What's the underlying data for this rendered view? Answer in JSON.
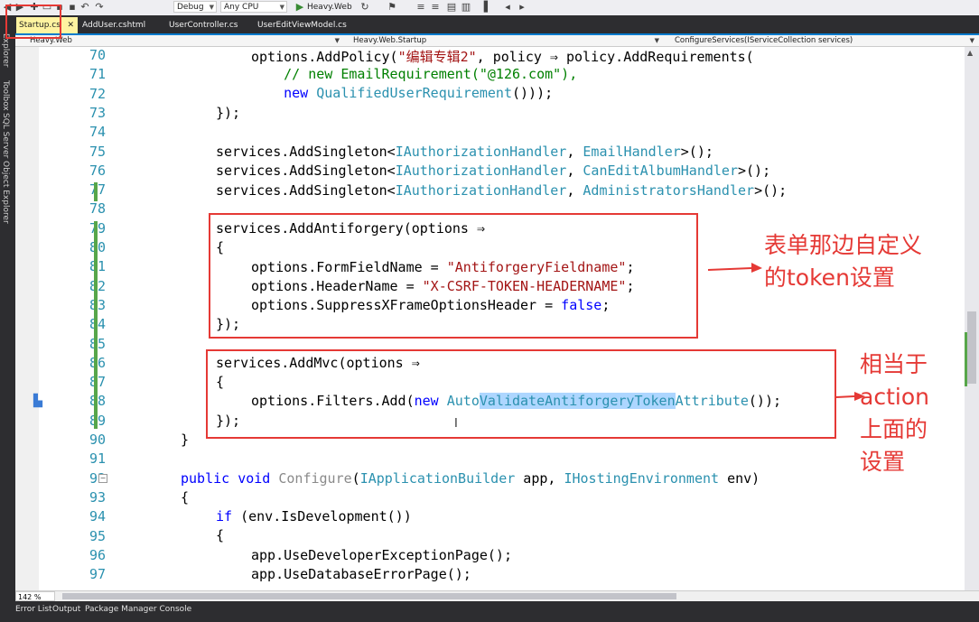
{
  "toolbar": {
    "config_label": "Debug",
    "platform_label": "Any CPU",
    "run_label": "Heavy.Web"
  },
  "tabs": [
    {
      "label": "Startup.cs"
    },
    {
      "label": "AddUser.cshtml"
    },
    {
      "label": "UserController.cs"
    },
    {
      "label": "UserEditViewModel.cs"
    }
  ],
  "left_rail": {
    "items": [
      "Explorer",
      "Toolbox",
      "SQL Server Object Explorer"
    ]
  },
  "navbar": {
    "project": "Heavy.Web",
    "class": "Heavy.Web.Startup",
    "member": "ConfigureServices(IServiceCollection services)"
  },
  "editor": {
    "line_numbers": [
      "70",
      "71",
      "72",
      "73",
      "74",
      "75",
      "76",
      "77",
      "78",
      "79",
      "80",
      "81",
      "82",
      "83",
      "84",
      "85",
      "86",
      "87",
      "88",
      "89",
      "90",
      "91",
      "92",
      "93",
      "94",
      "95",
      "96",
      "97"
    ],
    "zoom": "142 %"
  },
  "annotations": {
    "note1": "表单那边自定义的token设置",
    "note2": "相当于action上面的设置"
  },
  "statusbar": {
    "items": [
      "Error List",
      "Output",
      "Package Manager Console"
    ]
  },
  "colors": {
    "accent": "#007acc",
    "annotation": "#e53935",
    "keyword": "#0000ff",
    "type": "#2b91af",
    "string": "#a31515",
    "comment": "#008000"
  }
}
